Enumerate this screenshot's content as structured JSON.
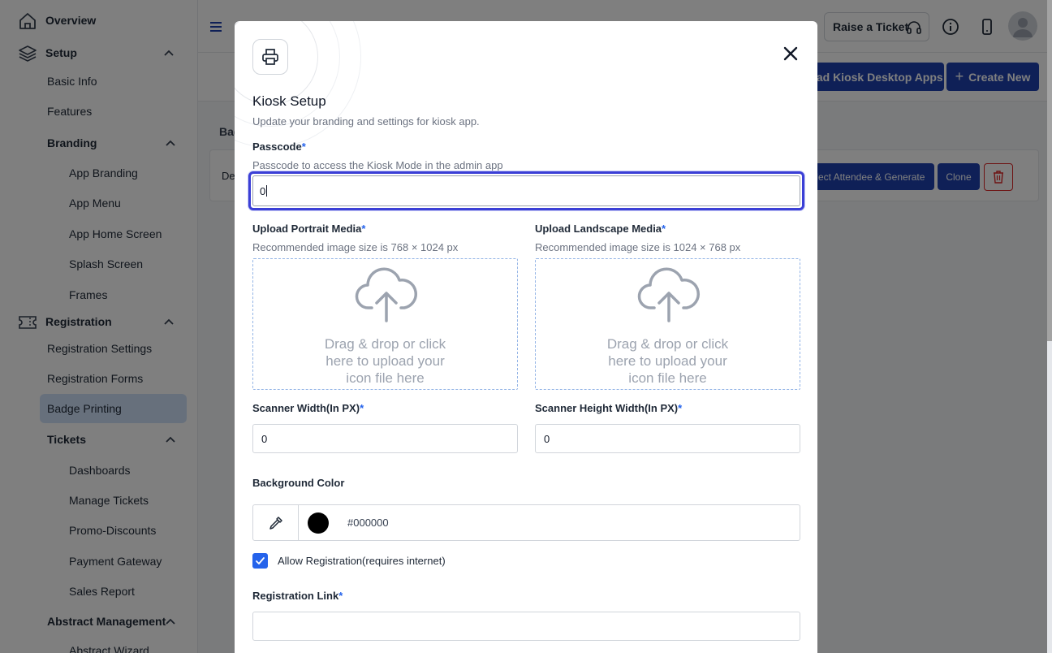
{
  "sidebar": {
    "items": [
      {
        "label": "Overview",
        "icon": "home-icon",
        "level": "top"
      },
      {
        "label": "Setup",
        "icon": "layers-icon",
        "level": "top",
        "expanded": true
      },
      {
        "label": "Basic Info",
        "level": "child"
      },
      {
        "label": "Features",
        "level": "child"
      },
      {
        "label": "Branding",
        "level": "sub",
        "expanded": true
      },
      {
        "label": "App Branding",
        "level": "grandchild"
      },
      {
        "label": "App Menu",
        "level": "grandchild"
      },
      {
        "label": "App Home Screen",
        "level": "grandchild"
      },
      {
        "label": "Splash Screen",
        "level": "grandchild"
      },
      {
        "label": "Frames",
        "level": "grandchild"
      },
      {
        "label": "Registration",
        "icon": "ticket-icon",
        "level": "top",
        "expanded": true
      },
      {
        "label": "Registration Settings",
        "level": "child"
      },
      {
        "label": "Registration Forms",
        "level": "child"
      },
      {
        "label": "Badge Printing",
        "level": "child",
        "active": true
      },
      {
        "label": "Tickets",
        "level": "sub",
        "expanded": true
      },
      {
        "label": "Dashboards",
        "level": "grandchild"
      },
      {
        "label": "Manage Tickets",
        "level": "grandchild"
      },
      {
        "label": "Promo-Discounts",
        "level": "grandchild"
      },
      {
        "label": "Payment Gateway",
        "level": "grandchild"
      },
      {
        "label": "Sales Report",
        "level": "grandchild"
      },
      {
        "label": "Abstract Management",
        "level": "sub",
        "expanded": true
      },
      {
        "label": "Abstract Wizard",
        "level": "grandchild"
      }
    ]
  },
  "header": {
    "raise_ticket": "Raise a Ticket",
    "download_kiosk": "Download Kiosk Desktop Apps",
    "create_new": "Create New"
  },
  "background_card": {
    "head_label": "Badge",
    "row_label": "Default",
    "select_generate": "Select Attendee & Generate",
    "clone": "Clone"
  },
  "modal": {
    "title": "Kiosk Setup",
    "subtitle": "Update your branding and settings for kiosk app.",
    "passcode": {
      "label": "Passcode",
      "required_mark": "*",
      "help": "Passcode to access the Kiosk Mode in the admin app",
      "value": "0"
    },
    "portrait": {
      "label": "Upload Portrait Media",
      "required_mark": "*",
      "help": "Recommended image size is 768 × 1024 px",
      "drop_line1": "Drag & drop or click",
      "drop_line2": "here to upload your",
      "drop_line3": "icon file here"
    },
    "landscape": {
      "label": "Upload Landscape Media",
      "required_mark": "*",
      "help": "Recommended image size is 1024 × 768 px",
      "drop_line1": "Drag & drop or click",
      "drop_line2": "here to upload your",
      "drop_line3": "icon file here"
    },
    "scanner_width": {
      "label": "Scanner Width(In PX)",
      "required_mark": "*",
      "value": "0"
    },
    "scanner_height": {
      "label": "Scanner Height Width(In PX)",
      "required_mark": "*",
      "value": "0"
    },
    "background_color": {
      "label": "Background Color",
      "value": "#000000",
      "swatch": "#000000"
    },
    "allow_registration": {
      "label": "Allow Registration(requires internet)",
      "checked": true
    },
    "registration_link": {
      "label": "Registration Link",
      "required_mark": "*",
      "value": ""
    }
  },
  "colors": {
    "accent": "#2563eb",
    "primary_button": "#1e40af",
    "active_nav_bg": "#cfe1f9",
    "focus_ring": "#3b3fd6",
    "delete_red": "#dc2626"
  }
}
